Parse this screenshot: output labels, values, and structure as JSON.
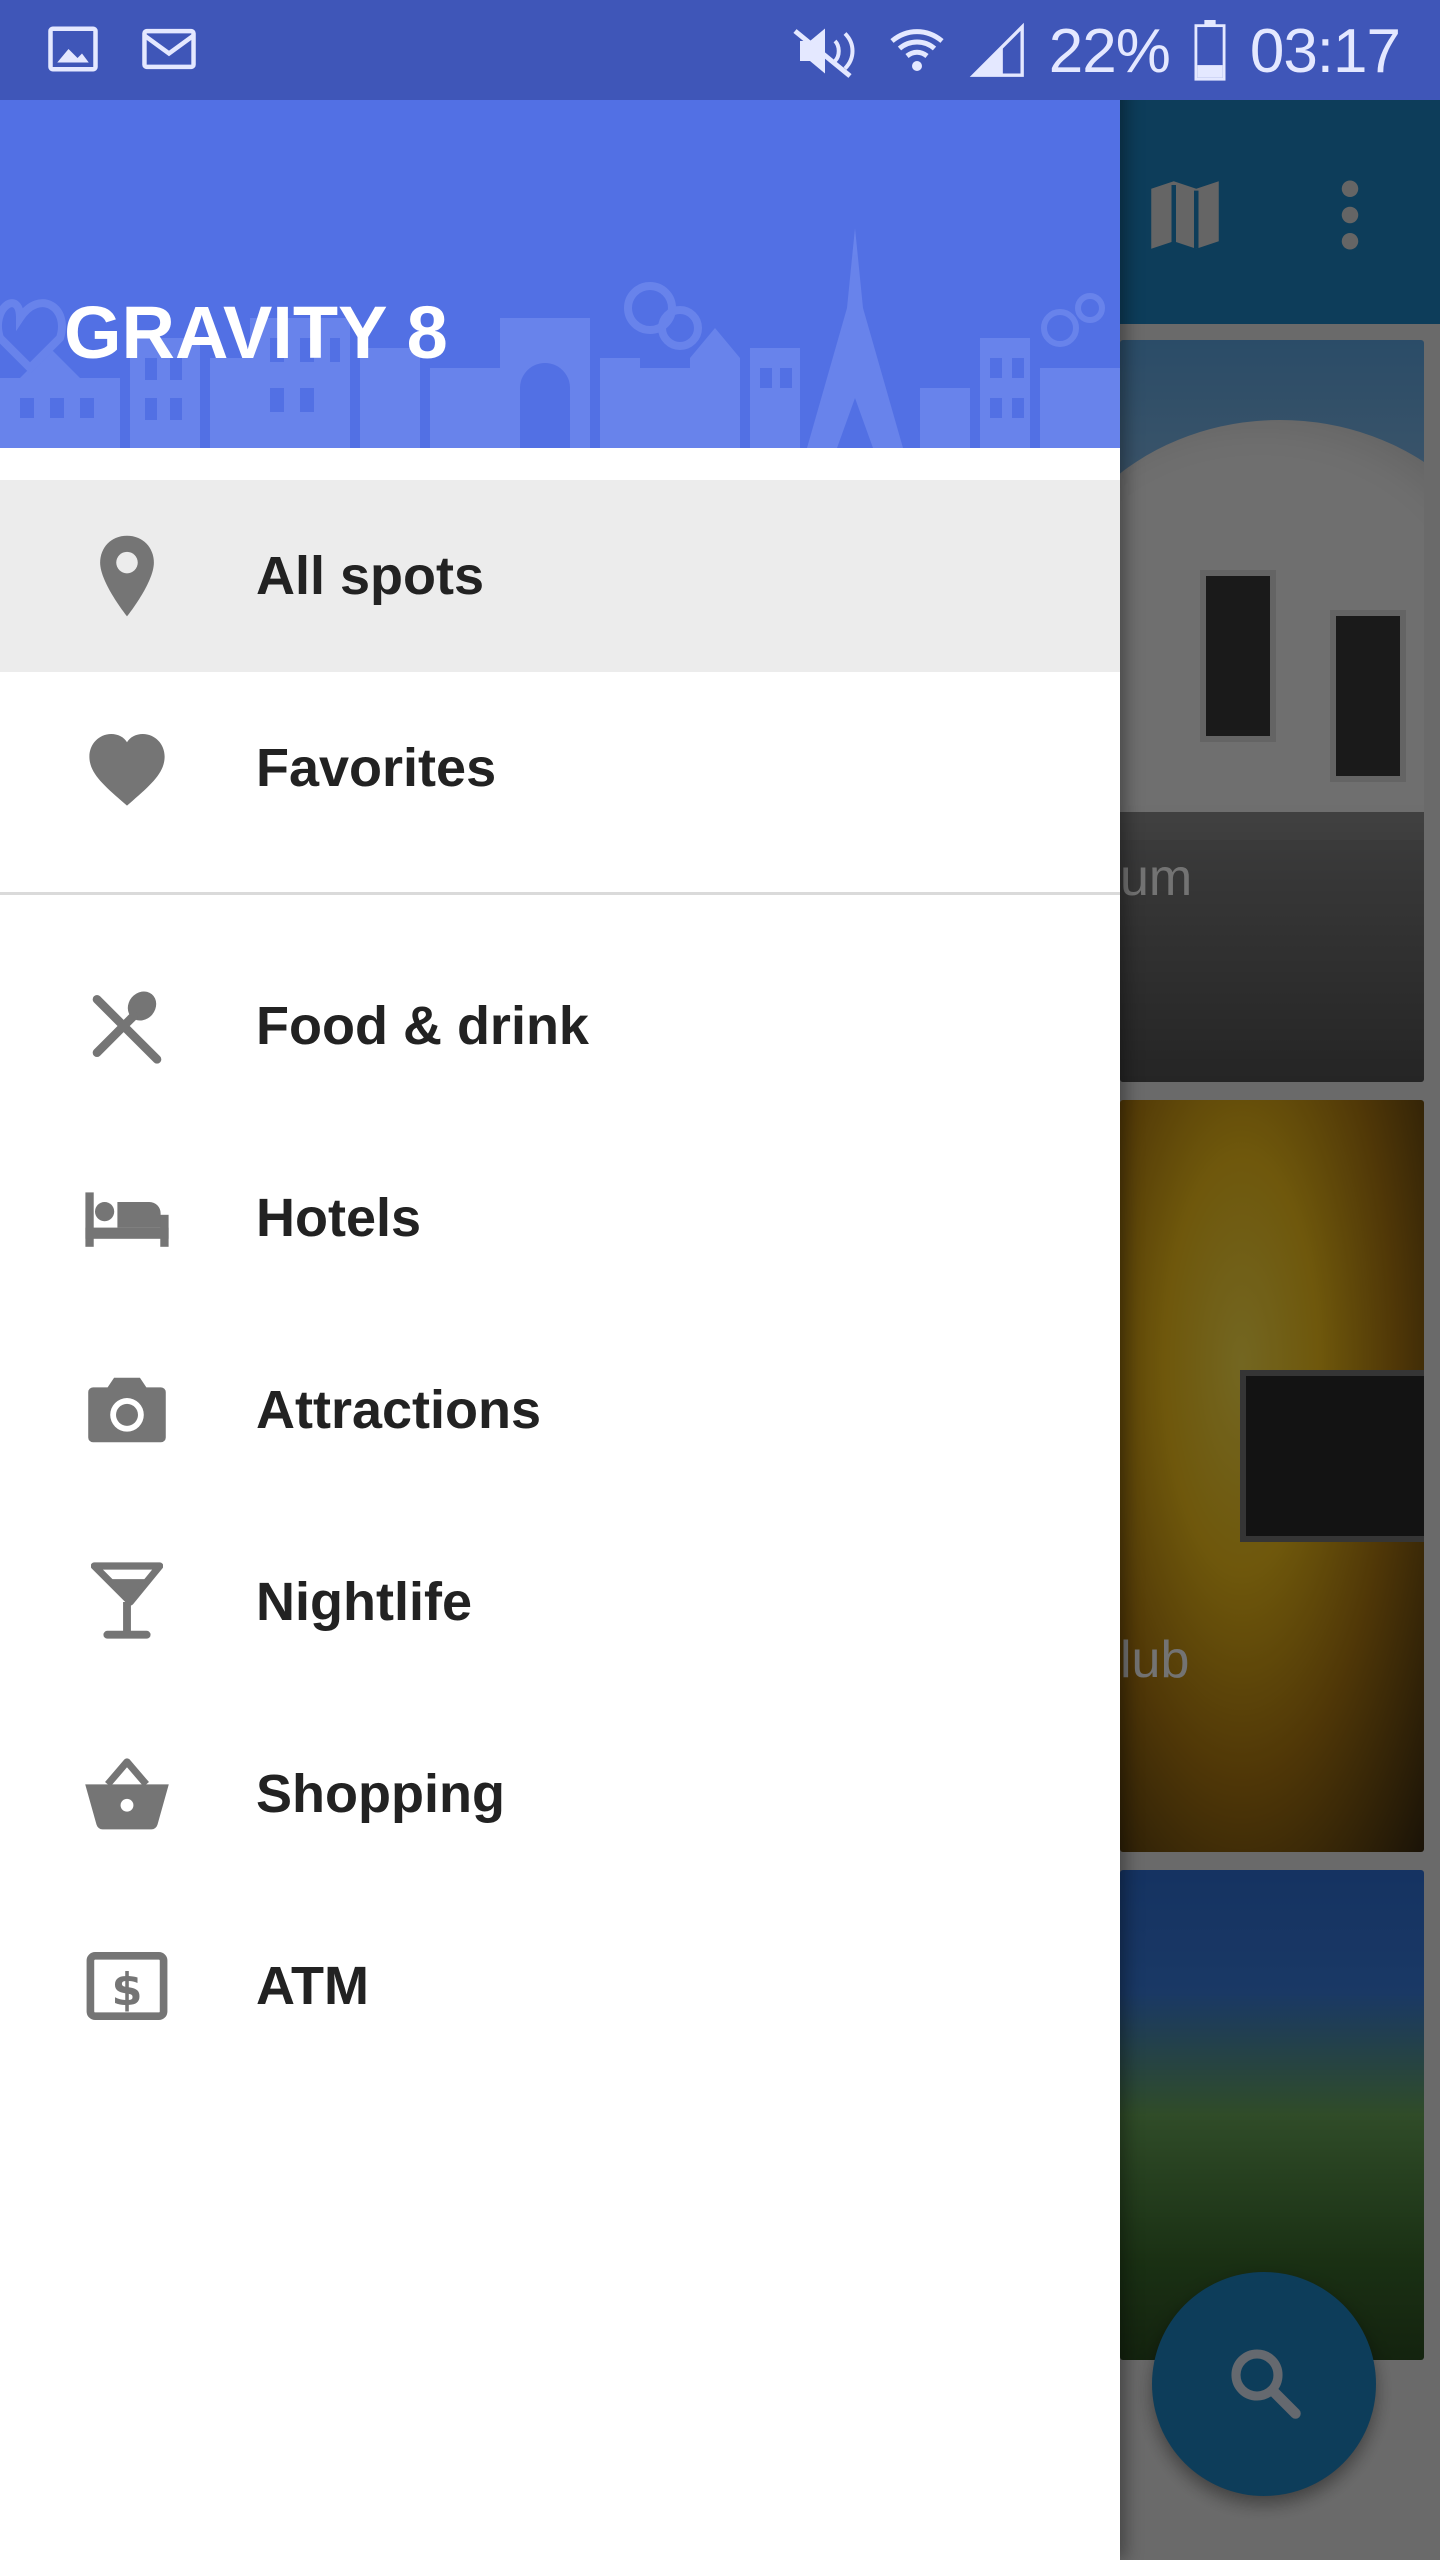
{
  "status_bar": {
    "left_icons": [
      "image-icon",
      "mail-icon"
    ],
    "right_icons": [
      "mute-icon",
      "wifi-icon",
      "signal-icon",
      "battery-icon"
    ],
    "battery": "22%",
    "time": "03:17"
  },
  "drawer": {
    "title": "GRAVITY 8",
    "primary_items": [
      {
        "label": "All spots",
        "icon": "map-pin-icon",
        "selected": true
      },
      {
        "label": "Favorites",
        "icon": "heart-icon",
        "selected": false
      }
    ],
    "category_items": [
      {
        "label": "Food & drink",
        "icon": "fork-spoon-icon"
      },
      {
        "label": "Hotels",
        "icon": "bed-icon"
      },
      {
        "label": "Attractions",
        "icon": "camera-icon"
      },
      {
        "label": "Nightlife",
        "icon": "cocktail-icon"
      },
      {
        "label": "Shopping",
        "icon": "basket-icon"
      },
      {
        "label": "ATM",
        "icon": "dollar-bill-icon"
      }
    ]
  },
  "background_app": {
    "toolbar_icons": [
      "map-icon",
      "more-vert-icon"
    ],
    "cards": [
      {
        "caption_fragment": "um"
      },
      {
        "caption_fragment": "lub"
      },
      {
        "caption_fragment": ""
      }
    ],
    "fab_icon": "search-icon"
  },
  "colors": {
    "status_bar": "#3f56b8",
    "drawer_header": "#5270e4",
    "toolbar": "#1e88c7",
    "selected_item_bg": "#ececec",
    "icon_gray": "#757575",
    "label_text": "#222222"
  }
}
